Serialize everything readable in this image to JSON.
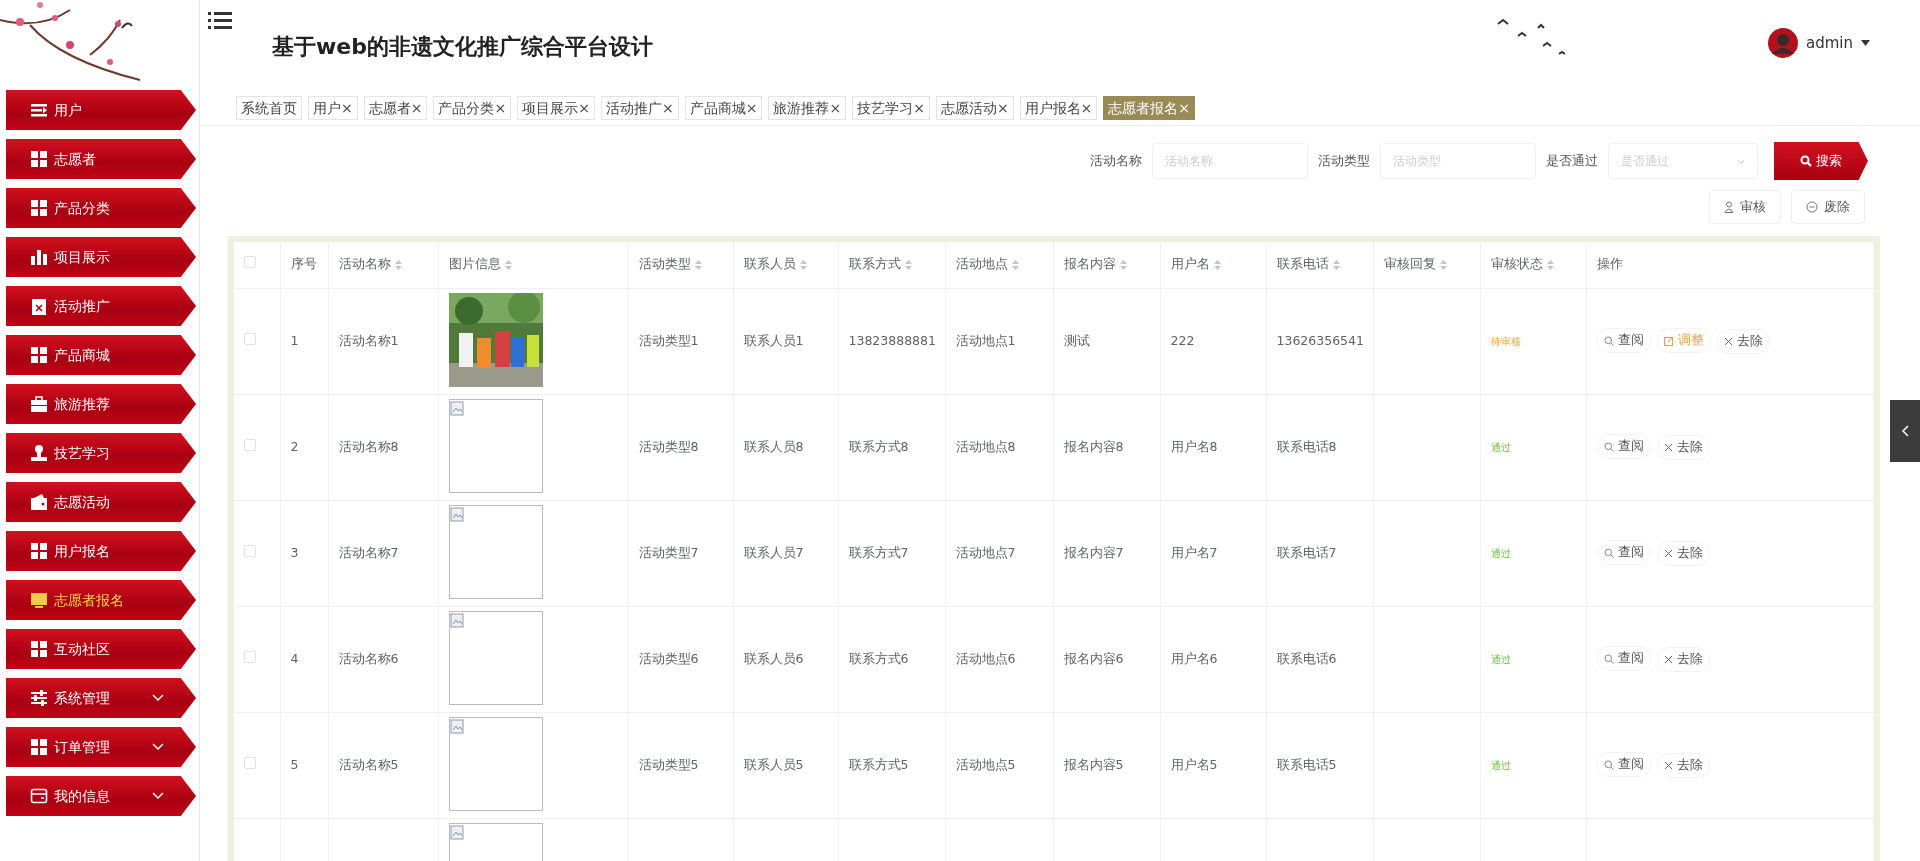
{
  "header": {
    "title": "基于web的非遗文化推广综合平台设计",
    "user": "admin"
  },
  "sidebar": {
    "items": [
      {
        "label": "用户",
        "kind": "link",
        "selected": false
      },
      {
        "label": "志愿者",
        "kind": "link",
        "selected": false
      },
      {
        "label": "产品分类",
        "kind": "link",
        "selected": false
      },
      {
        "label": "项目展示",
        "kind": "link",
        "selected": false
      },
      {
        "label": "活动推广",
        "kind": "link",
        "selected": false
      },
      {
        "label": "产品商城",
        "kind": "link",
        "selected": false
      },
      {
        "label": "旅游推荐",
        "kind": "link",
        "selected": false
      },
      {
        "label": "技艺学习",
        "kind": "link",
        "selected": false
      },
      {
        "label": "志愿活动",
        "kind": "link",
        "selected": false
      },
      {
        "label": "用户报名",
        "kind": "link",
        "selected": false
      },
      {
        "label": "志愿者报名",
        "kind": "link",
        "selected": true
      },
      {
        "label": "互动社区",
        "kind": "link",
        "selected": false
      },
      {
        "label": "系统管理",
        "kind": "group",
        "selected": false
      },
      {
        "label": "订单管理",
        "kind": "group",
        "selected": false
      },
      {
        "label": "我的信息",
        "kind": "group",
        "selected": false
      }
    ]
  },
  "tabs": [
    {
      "label": "系统首页",
      "selected": false
    },
    {
      "label": "用户",
      "close": "×",
      "selected": false
    },
    {
      "label": "志愿者",
      "close": "×",
      "selected": false
    },
    {
      "label": "产品分类",
      "close": "×",
      "selected": false
    },
    {
      "label": "项目展示",
      "close": "×",
      "selected": false
    },
    {
      "label": "活动推广",
      "close": "×",
      "selected": false
    },
    {
      "label": "产品商城",
      "close": "×",
      "selected": false
    },
    {
      "label": "旅游推荐",
      "close": "×",
      "selected": false
    },
    {
      "label": "技艺学习",
      "close": "×",
      "selected": false
    },
    {
      "label": "志愿活动",
      "close": "×",
      "selected": false
    },
    {
      "label": "用户报名",
      "close": "×",
      "selected": false
    },
    {
      "label": "志愿者报名",
      "close": "×",
      "selected": true
    }
  ],
  "search": {
    "fields": [
      {
        "label": "活动名称",
        "placeholder": "活动名称",
        "kind": "input"
      },
      {
        "label": "活动类型",
        "placeholder": "活动类型",
        "kind": "input"
      },
      {
        "label": "是否通过",
        "placeholder": "是否通过",
        "kind": "select"
      }
    ],
    "button": "搜索"
  },
  "actions": [
    {
      "label": "审核",
      "kind": "audit"
    },
    {
      "label": "废除",
      "kind": "cancel"
    }
  ],
  "table": {
    "columns": [
      {
        "label": "序号",
        "sortable": false
      },
      {
        "label": "活动名称",
        "sortable": true
      },
      {
        "label": "图片信息",
        "sortable": true
      },
      {
        "label": "活动类型",
        "sortable": true
      },
      {
        "label": "联系人员",
        "sortable": true
      },
      {
        "label": "联系方式",
        "sortable": true
      },
      {
        "label": "活动地点",
        "sortable": true
      },
      {
        "label": "报名内容",
        "sortable": true
      },
      {
        "label": "用户名",
        "sortable": true
      },
      {
        "label": "联系电话",
        "sortable": true
      },
      {
        "label": "审核回复",
        "sortable": true
      },
      {
        "label": "审核状态",
        "sortable": true
      },
      {
        "label": "操作",
        "sortable": false
      }
    ],
    "all_checked": false,
    "rows": [
      {
        "checked": false,
        "cells": [
          "1",
          "活动名称1"
        ],
        "image": {
          "kind": "picture"
        },
        "rest": [
          "活动类型1",
          "联系人员1",
          "13823888881",
          "活动地点1",
          "测试",
          "222",
          "13626356541"
        ],
        "status": "待审核",
        "kind": "pending",
        "buttons": [
          {
            "label": "查阅",
            "kind": "view"
          },
          {
            "label": "调整",
            "kind": "edit"
          },
          {
            "label": "去除",
            "kind": "delete"
          }
        ]
      },
      {
        "checked": false,
        "cells": [
          "2",
          "活动名称8"
        ],
        "image": {
          "kind": "broken"
        },
        "rest": [
          "活动类型8",
          "联系人员8",
          "联系方式8",
          "活动地点8",
          "报名内容8",
          "用户名8",
          "联系电话8"
        ],
        "status": "通过",
        "kind": "approved",
        "buttons": [
          {
            "label": "查阅",
            "kind": "view"
          },
          {
            "label": "去除",
            "kind": "delete"
          }
        ]
      },
      {
        "checked": false,
        "cells": [
          "3",
          "活动名称7"
        ],
        "image": {
          "kind": "broken"
        },
        "rest": [
          "活动类型7",
          "联系人员7",
          "联系方式7",
          "活动地点7",
          "报名内容7",
          "用户名7",
          "联系电话7"
        ],
        "status": "通过",
        "kind": "approved",
        "buttons": [
          {
            "label": "查阅",
            "kind": "view"
          },
          {
            "label": "去除",
            "kind": "delete"
          }
        ]
      },
      {
        "checked": false,
        "cells": [
          "4",
          "活动名称6"
        ],
        "image": {
          "kind": "broken"
        },
        "rest": [
          "活动类型6",
          "联系人员6",
          "联系方式6",
          "活动地点6",
          "报名内容6",
          "用户名6",
          "联系电话6"
        ],
        "status": "通过",
        "kind": "approved",
        "buttons": [
          {
            "label": "查阅",
            "kind": "view"
          },
          {
            "label": "去除",
            "kind": "delete"
          }
        ]
      },
      {
        "checked": false,
        "cells": [
          "5",
          "活动名称5"
        ],
        "image": {
          "kind": "broken"
        },
        "rest": [
          "活动类型5",
          "联系人员5",
          "联系方式5",
          "活动地点5",
          "报名内容5",
          "用户名5",
          "联系电话5"
        ],
        "status": "通过",
        "kind": "approved",
        "buttons": [
          {
            "label": "查阅",
            "kind": "view"
          },
          {
            "label": "去除",
            "kind": "delete"
          }
        ]
      },
      {
        "image": {
          "kind": "broken"
        }
      }
    ]
  }
}
